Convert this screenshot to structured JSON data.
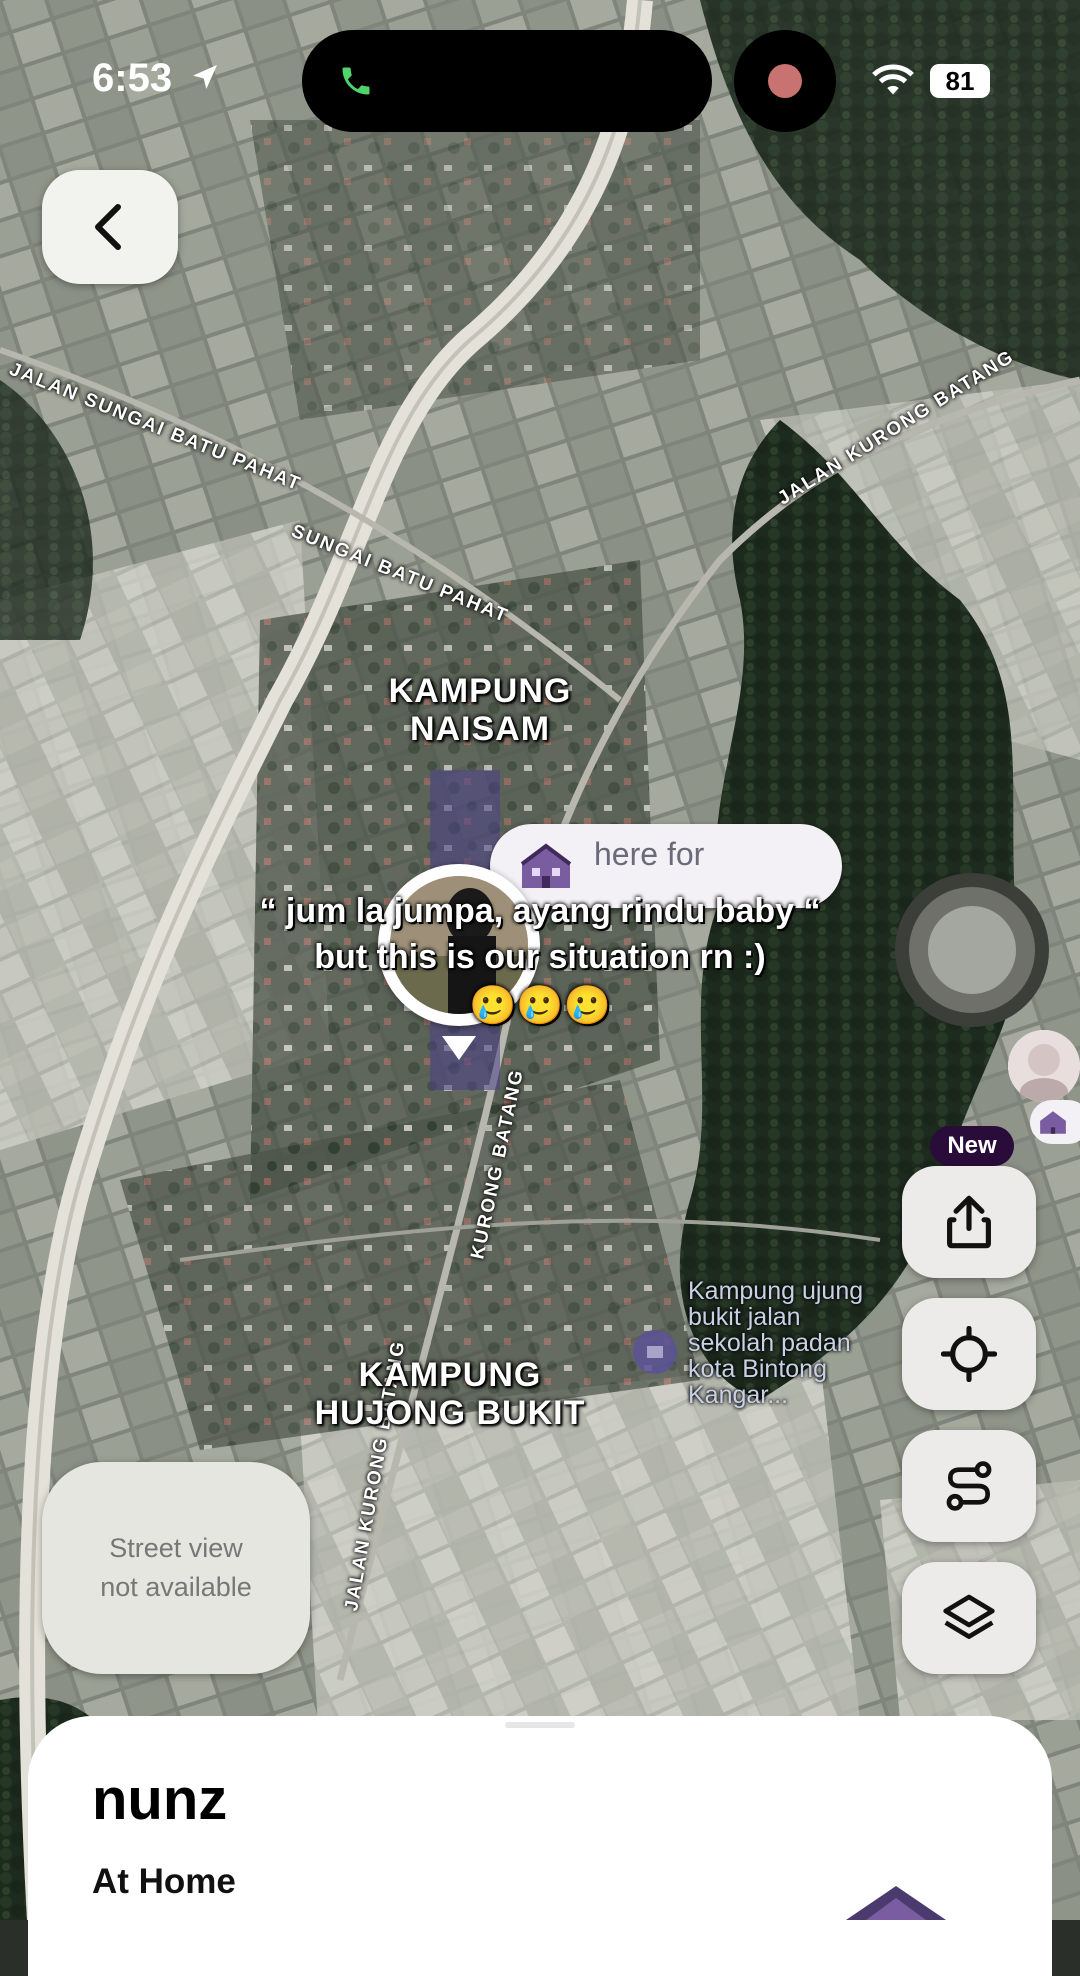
{
  "status_bar": {
    "time": "6:53",
    "battery": "81"
  },
  "map": {
    "areas": [
      {
        "line1": "KAMPUNG",
        "line2": "NAISAM"
      },
      {
        "line1": "KAMPUNG",
        "line2": "HUJONG BUKIT"
      }
    ],
    "roads": {
      "road_1": "JALAN SUNGAI BATU PAHAT",
      "road_2": "SUNGAI BATU PAHAT",
      "road_3": "JALAN KURONG BATANG",
      "road_4": "JALAN KURONG BATANG",
      "road_5": "KURONG BATANG"
    },
    "poi": {
      "lines": [
        "Kampung ujung",
        "bukit jalan",
        "sekolah padan",
        "kota Bintong",
        "Kangar..."
      ]
    }
  },
  "bubble": {
    "text": "here for"
  },
  "caption": {
    "line1": "“ jum la jumpa, ayang rindu baby “",
    "line2": "but this is our situation rn :)",
    "line3": "🥲🥲🥲"
  },
  "controls": {
    "new_badge": "New",
    "street_view": {
      "line1": "Street view",
      "line2": "not available"
    }
  },
  "sheet": {
    "name": "nunz",
    "status": "At Home"
  },
  "colors": {
    "sheet_bg": "#ffffff",
    "badge_bg": "#2a0c3a",
    "button_bg": "#ecebea"
  }
}
